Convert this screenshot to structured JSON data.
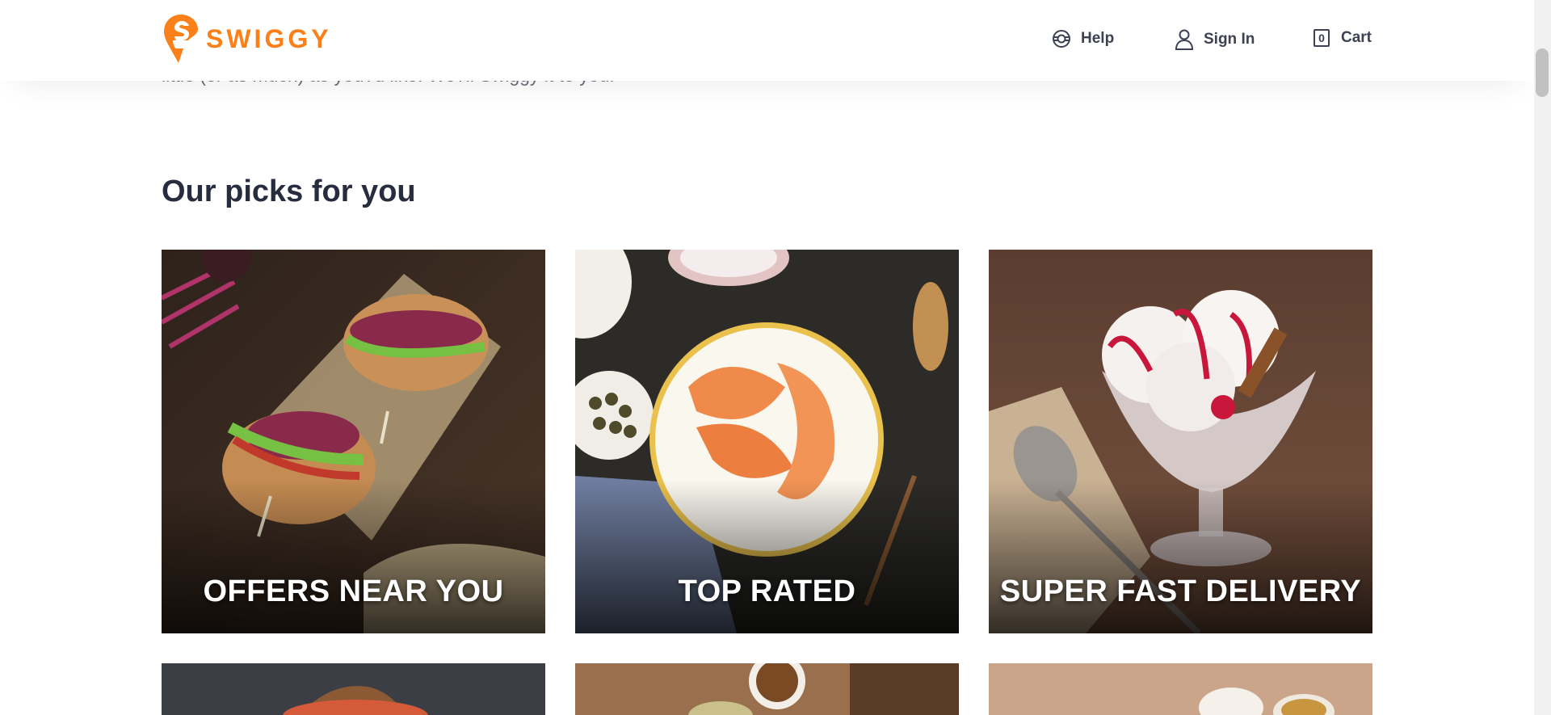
{
  "header": {
    "logo_text": "SWIGGY",
    "nav": {
      "help_label": "Help",
      "signin_label": "Sign In",
      "cart_label": "Cart",
      "cart_count": "0"
    }
  },
  "intro": {
    "text": "little (or as much) as you?d like. We?ll Swiggy it to you!"
  },
  "picks": {
    "title": "Our picks for you",
    "cards": [
      {
        "label": "OFFERS NEAR YOU"
      },
      {
        "label": "TOP RATED"
      },
      {
        "label": "SUPER FAST DELIVERY"
      }
    ]
  },
  "colors": {
    "brand": "#fc8019",
    "text_dark": "#282c3f",
    "text_muted": "#686b78"
  },
  "icons": [
    "swiggy-logo-icon",
    "help-lifebuoy-icon",
    "user-icon",
    "cart-bag-icon"
  ]
}
